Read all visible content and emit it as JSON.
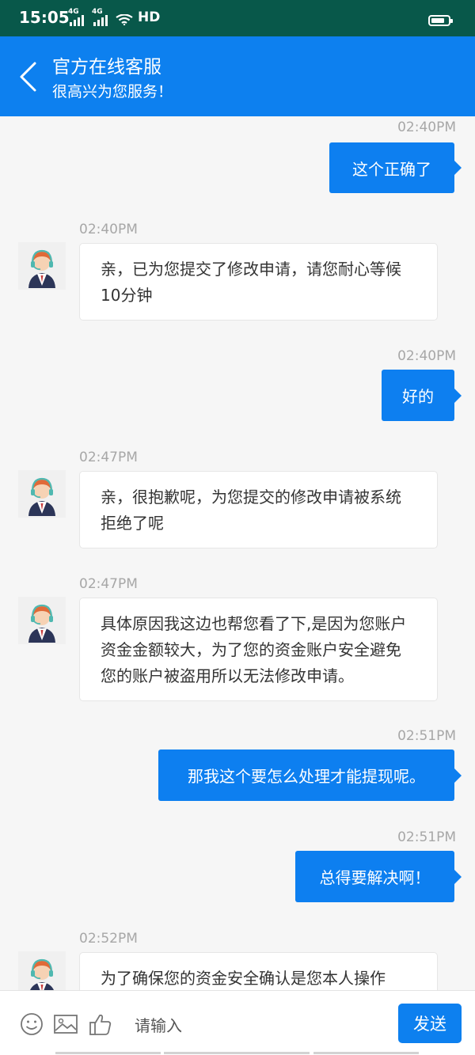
{
  "status_bar": {
    "time": "15:05",
    "signal_1": "4G",
    "signal_2": "4G",
    "hd": "HD",
    "battery_level": 0.8,
    "icons": [
      "signal-icon",
      "wifi-icon",
      "battery-icon"
    ]
  },
  "header": {
    "title": "官方在线客服",
    "subtitle": "很高兴为您服务！",
    "back_icon": "chevron-left-icon"
  },
  "messages": [
    {
      "side": "out",
      "time": "02:40PM",
      "text": "这个正确了"
    },
    {
      "side": "in",
      "time": "02:40PM",
      "text": "亲，已为您提交了修改申请，请您耐心等候10分钟"
    },
    {
      "side": "out",
      "time": "02:40PM",
      "text": "好的"
    },
    {
      "side": "in",
      "time": "02:47PM",
      "text": "亲，很抱歉呢，为您提交的修改申请被系统拒绝了呢"
    },
    {
      "side": "in",
      "time": "02:47PM",
      "text": "具体原因我这边也帮您看了下,是因为您账户资金金额较大，为了您的资金账户安全避免您的账户被盗用所以无法修改申请。"
    },
    {
      "side": "out",
      "time": "02:51PM",
      "text": "那我这个要怎么处理才能提现呢。"
    },
    {
      "side": "out",
      "time": "02:51PM",
      "text": "总得要解决啊！"
    },
    {
      "side": "in",
      "time": "02:52PM",
      "text": "为了确保您的资金安全确认是您本人操作"
    }
  ],
  "input_bar": {
    "placeholder": "请输入",
    "send_label": "发送",
    "icons": [
      "emoji-icon",
      "image-icon",
      "thumbs-up-icon"
    ]
  },
  "colors": {
    "status_bar_bg": "#08584a",
    "header_bg": "#0d80ef",
    "outgoing_bubble": "#0d7ff0",
    "incoming_bubble": "#ffffff",
    "chat_bg": "#f6f6f6",
    "timestamp_text": "#a7a7a7"
  }
}
